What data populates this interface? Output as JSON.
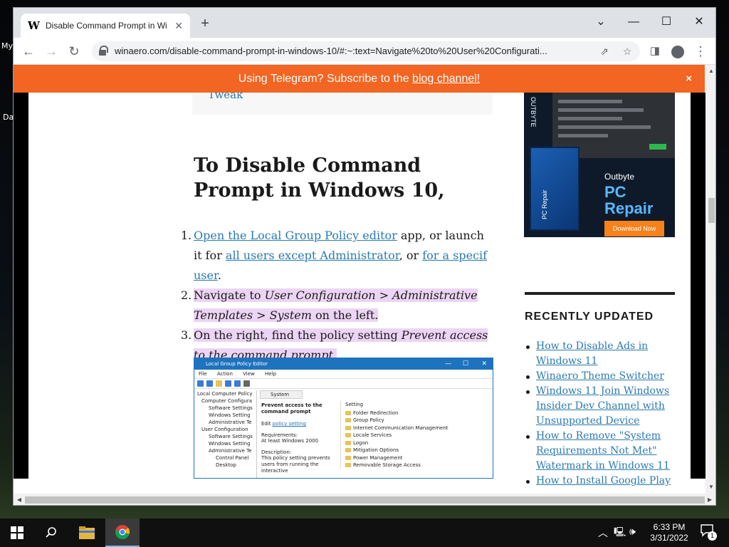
{
  "desktop": {
    "icon_labels": [
      "My",
      "Da"
    ]
  },
  "browser": {
    "tab_title": "Disable Command Prompt in Wi",
    "favicon_letter": "W",
    "new_tab": "+",
    "url": "winaero.com/disable-command-prompt-in-windows-10/#:~:text=Navigate%20to%20User%20Configurati..."
  },
  "banner": {
    "text_before": "Using Telegram? Subscribe to the ",
    "link": "blog channel!",
    "close": "×"
  },
  "article": {
    "partial_link": "Tweak",
    "heading": "To Disable Command Prompt in Windows 10,",
    "step1": {
      "num": "1.",
      "link1": "Open the Local Group Policy editor",
      "text1": " app, or launch it for ",
      "link2": "all users except Administrator",
      "text2": ", or ",
      "link3": "for a specif user",
      "text3": "."
    },
    "step2": {
      "num": "2.",
      "text1": "Navigate to ",
      "em": "User Configuration > Administrative Templates > System",
      "text2": " on the left."
    },
    "step3": {
      "num": "3.",
      "text1": "On the right, find the policy setting ",
      "em": "Prevent access to the command prompt",
      "text2": "."
    }
  },
  "gpedit": {
    "title": "Local Group Policy Editor",
    "menu": [
      "File",
      "Action",
      "View",
      "Help"
    ],
    "tree": [
      "Local Computer Policy",
      "Computer Configura",
      "Software Settings",
      "Windows Setting",
      "Administrative Te",
      "User Configuration",
      "Software Settings",
      "Windows Setting",
      "Administrative Te",
      "Control Panel",
      "Desktop"
    ],
    "tab": "System",
    "desc_title": "Prevent access to the command prompt",
    "edit_text": "Edit ",
    "edit_link": "policy setting",
    "requirements": "Requirements:",
    "requirements_val": "At least Windows 2000",
    "description": "Description:",
    "description_val": "This policy setting prevents users from running the interactive",
    "list_header": "Setting",
    "list": [
      "Folder Redirection",
      "Group Policy",
      "Internet Communication Management",
      "Locale Services",
      "Logon",
      "Mitigation Options",
      "Power Management",
      "Removable Storage Access"
    ]
  },
  "sidebar": {
    "ad_brand_vertical": "OUTBYTE",
    "ad_box_label": "PC Repair",
    "ad_brand": "Outbyte",
    "ad_product": "PC Repair",
    "ad_button": "Download Now",
    "heading": "RECENTLY UPDATED",
    "items": [
      "How to Disable Ads in Windows 11",
      "Winaero Theme Switcher",
      "Windows 11 Join Windows Insider Dev Channel with Unsupported Device",
      "How to Remove \"System Requirements Not Met\" Watermark in Windows 11",
      "How to Install Google Play"
    ]
  },
  "taskbar": {
    "time": "6:33 PM",
    "date": "3/31/2022",
    "notification_count": "1"
  },
  "colors": {
    "banner": "#f26522",
    "link": "#2a7ab0",
    "highlight": "#ecd4f4"
  }
}
